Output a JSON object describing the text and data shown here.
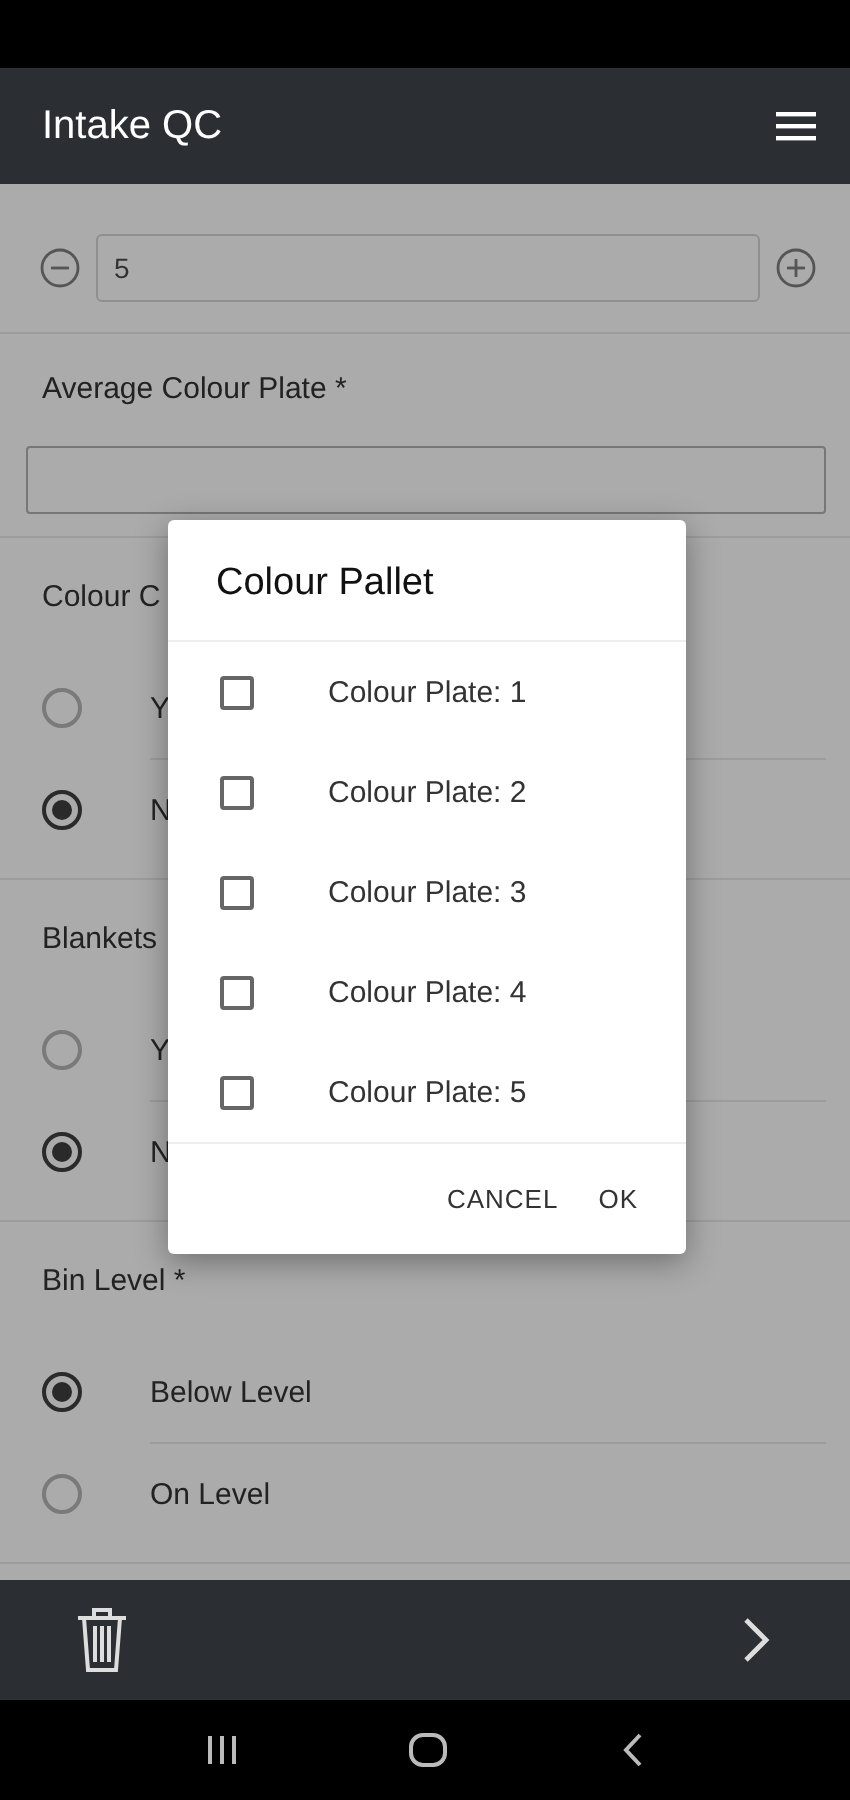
{
  "app_bar": {
    "title": "Intake QC"
  },
  "form": {
    "stepper": {
      "value": "5"
    },
    "fields": [
      {
        "kind": "input",
        "label": "Average Colour Plate *"
      },
      {
        "kind": "radio",
        "label": "Colour C",
        "options": [
          {
            "label": "Y",
            "selected": false
          },
          {
            "label": "N",
            "selected": true
          }
        ]
      },
      {
        "kind": "radio",
        "label": "Blankets",
        "options": [
          {
            "label": "Y",
            "selected": false
          },
          {
            "label": "N",
            "selected": true
          }
        ]
      },
      {
        "kind": "radio",
        "label": "Bin Level *",
        "options": [
          {
            "label": "Below Level",
            "selected": true
          },
          {
            "label": "On Level",
            "selected": false
          }
        ]
      }
    ]
  },
  "dialog": {
    "title": "Colour Pallet",
    "items": [
      {
        "label": "Colour Plate: 1",
        "checked": false
      },
      {
        "label": "Colour Plate: 2",
        "checked": false
      },
      {
        "label": "Colour Plate: 3",
        "checked": false
      },
      {
        "label": "Colour Plate: 4",
        "checked": false
      },
      {
        "label": "Colour Plate: 5",
        "checked": false
      }
    ],
    "buttons": [
      "CANCEL",
      "OK"
    ]
  }
}
